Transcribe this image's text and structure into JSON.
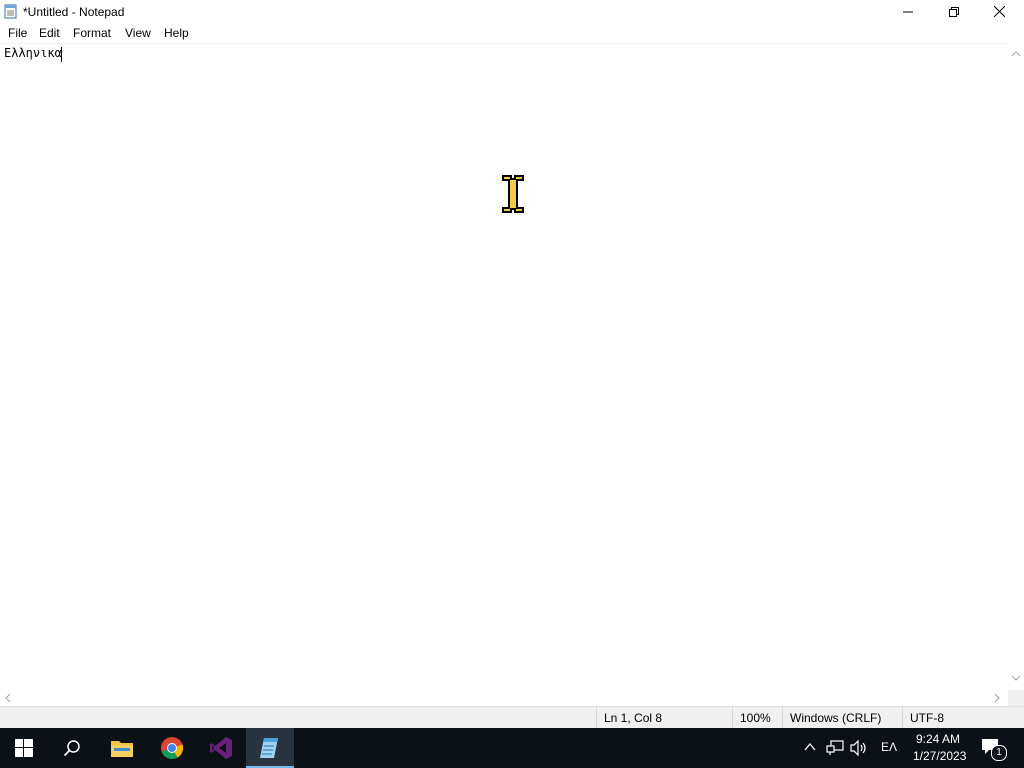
{
  "window": {
    "title": "*Untitled - Notepad",
    "controls": {
      "minimize": "minimize-icon",
      "restore": "restore-icon",
      "close": "close-icon"
    }
  },
  "menu": {
    "items": [
      "File",
      "Edit",
      "Format",
      "View",
      "Help"
    ]
  },
  "editor": {
    "content": "Ελληνικα"
  },
  "status": {
    "position": "Ln 1, Col 8",
    "zoom": "100%",
    "line_ending": "Windows (CRLF)",
    "encoding": "UTF-8"
  },
  "taskbar": {
    "apps": [
      "start-icon",
      "search-icon",
      "file-explorer-icon",
      "chrome-icon",
      "visual-studio-icon",
      "notepad-icon"
    ],
    "active_app": "notepad-icon",
    "tray": {
      "language": "ΕΛ",
      "time": "9:24 AM",
      "date": "1/27/2023",
      "notification_count": "1"
    }
  },
  "colors": {
    "taskbar": "#0c1118",
    "accent": "#76b9ed",
    "vs_purple": "#68217a"
  }
}
